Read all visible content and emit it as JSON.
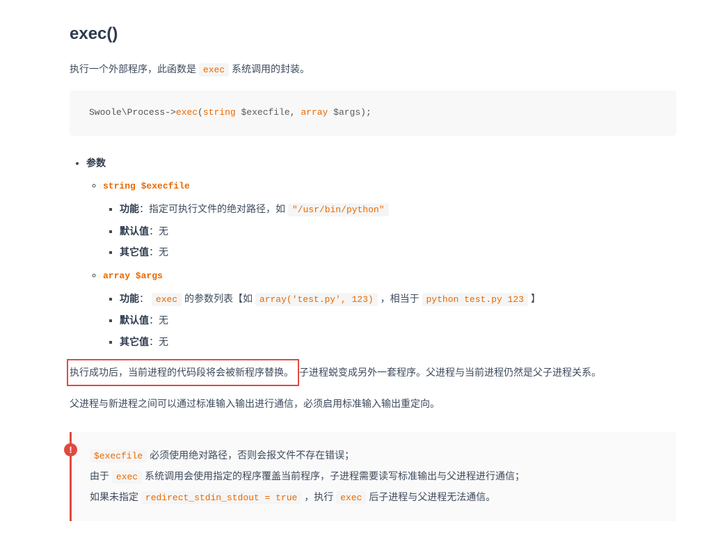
{
  "method": {
    "name": "exec()",
    "intro_before": "执行一个外部程序，此函数是 ",
    "intro_code": "exec",
    "intro_after": " 系统调用的封装。"
  },
  "signature": {
    "prefix": "Swoole\\Process->",
    "fn": "exec",
    "p1_type": "string",
    "p1_name": "$execfile",
    "p2_type": "array",
    "p2_name": "$args"
  },
  "params_heading": "参数",
  "param1": {
    "decl": "string $execfile",
    "l1_label": "功能",
    "l1_text": "：指定可执行文件的绝对路径，如 ",
    "l1_code": "\"/usr/bin/python\"",
    "l2_label": "默认值",
    "l2_text": "：无",
    "l3_label": "其它值",
    "l3_text": "：无"
  },
  "param2": {
    "decl": "array $args",
    "l1_label": "功能",
    "l1_sep": "：",
    "l1_code1": "exec",
    "l1_text1": " 的参数列表【如 ",
    "l1_code2": "array('test.py', 123)",
    "l1_text2": " ，相当于 ",
    "l1_code3": "python test.py 123",
    "l1_text3": " 】",
    "l2_label": "默认值",
    "l2_text": "：无",
    "l3_label": "其它值",
    "l3_text": "：无"
  },
  "result": {
    "highlighted": "执行成功后，当前进程的代码段将会被新程序替换。",
    "rest": "子进程蜕变成另外一套程序。父进程与当前进程仍然是父子进程关系。"
  },
  "extra": "父进程与新进程之间可以通过标准输入输出进行通信，必须启用标准输入输出重定向。",
  "note": {
    "l1_code": "$execfile",
    "l1_text": " 必须使用绝对路径，否则会报文件不存在错误；",
    "l2_before": "由于 ",
    "l2_code": "exec",
    "l2_after": " 系统调用会使用指定的程序覆盖当前程序，子进程需要读写标准输出与父进程进行通信；",
    "l3_before": "如果未指定 ",
    "l3_code": "redirect_stdin_stdout = true",
    "l3_mid": " ，执行 ",
    "l3_code2": "exec",
    "l3_after": " 后子进程与父进程无法通信。"
  }
}
